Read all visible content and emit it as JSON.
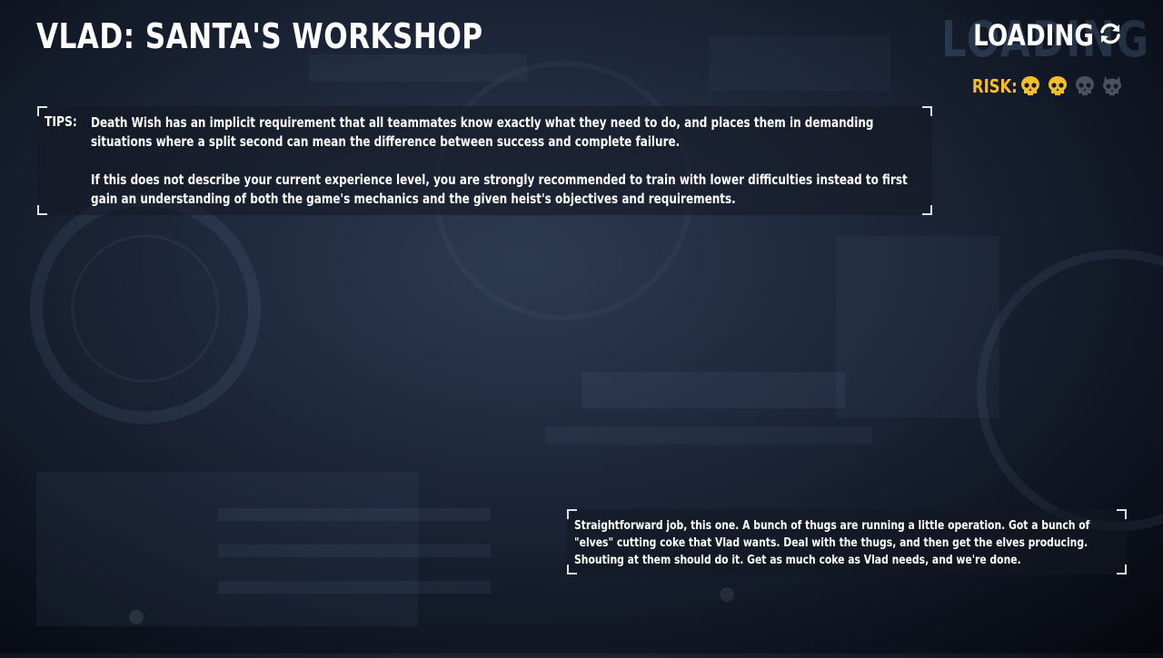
{
  "heist": {
    "title": "VLAD: SANTA'S WORKSHOP"
  },
  "loading": {
    "label": "LOADING",
    "background_word": "LOADING",
    "icon": "refresh-icon"
  },
  "risk": {
    "label": "RISK:",
    "level": 2,
    "max_level": 4,
    "active_color": "#f2bf2a",
    "inactive_color": "#4a5160",
    "icon": "skull-icon"
  },
  "tips": {
    "label": "TIPS:",
    "paragraph_1": "Death Wish has an implicit requirement that all teammates know exactly what they need to do, and places them in demanding situations where a split second can mean the difference between success and complete failure.",
    "paragraph_2": "If this does not describe your current experience level, you are strongly recommended to train with lower difficulties instead to first gain an understanding of both the game's mechanics and the given heist's objectives and requirements."
  },
  "briefing": {
    "text": "Straightforward job, this one. A bunch of thugs are running a little operation. Got a bunch of \"elves\" cutting coke that Vlad wants. Deal with the thugs, and then get the elves producing. Shouting at them should do it. Get as much coke as Vlad needs, and we're done."
  }
}
